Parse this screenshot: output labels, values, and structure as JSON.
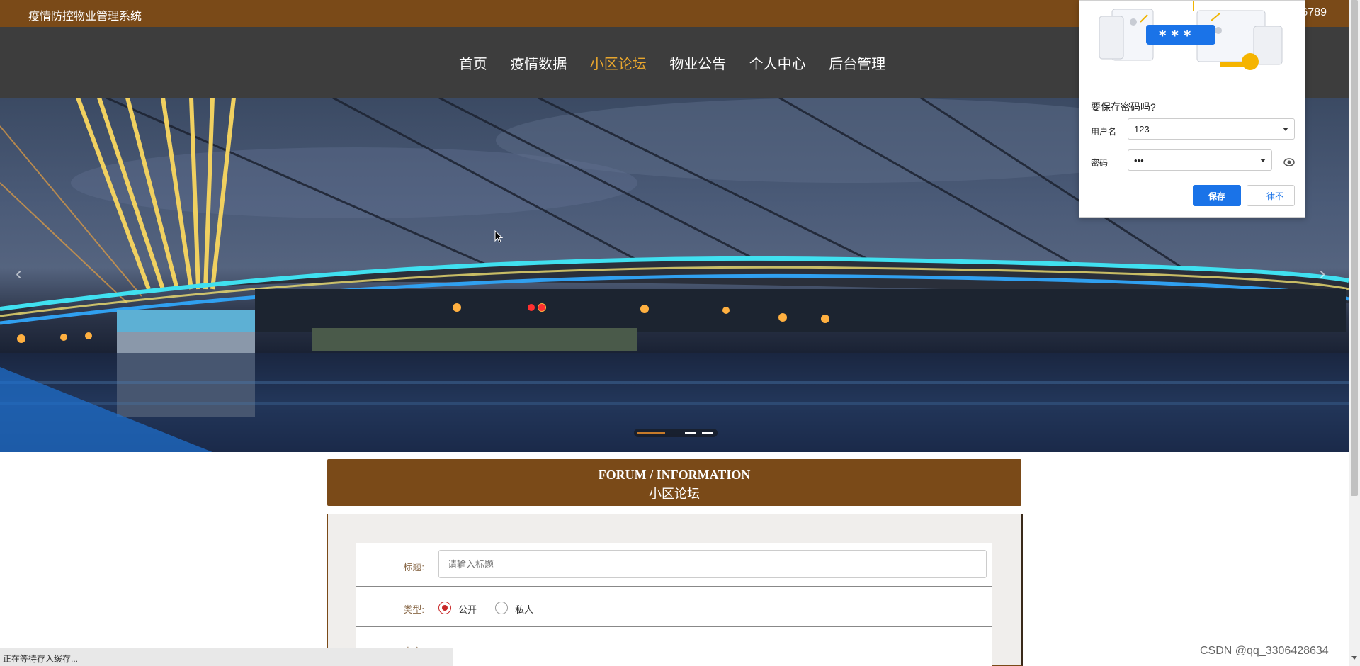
{
  "topbar": {
    "system_title": "疫情防控物业管理系统",
    "phone_fragment": "6789"
  },
  "nav": {
    "items": [
      {
        "label": "首页",
        "active": false
      },
      {
        "label": "疫情数据",
        "active": false
      },
      {
        "label": "小区论坛",
        "active": true
      },
      {
        "label": "物业公告",
        "active": false
      },
      {
        "label": "个人中心",
        "active": false
      },
      {
        "label": "后台管理",
        "active": false
      }
    ]
  },
  "banner": {
    "prev_glyph": "‹",
    "next_glyph": "›",
    "slide_count": 3,
    "active_slide": 1
  },
  "forum": {
    "title_en": "FORUM / INFORMATION",
    "title_cn": "小区论坛",
    "form": {
      "title_label": "标题:",
      "title_placeholder": "请输入标题",
      "type_label": "类型:",
      "type_options": [
        "公开",
        "私人"
      ],
      "type_selected": "公开",
      "content_label": "内容:"
    }
  },
  "password_popup": {
    "question": "要保存密码吗?",
    "username_label": "用户名",
    "username_value": "123",
    "password_label": "密码",
    "password_value": "•••",
    "save_label": "保存",
    "never_label": "一律不",
    "illustration_text": "* * *"
  },
  "statusbar": {
    "text": "正在等待存入缓存..."
  },
  "watermark": {
    "text": "CSDN @qq_3306428634"
  },
  "colors": {
    "brand": "#7a4a18",
    "nav_bg": "#3d3d3d",
    "nav_active": "#e8a62e",
    "chrome_blue": "#1a73e8"
  }
}
